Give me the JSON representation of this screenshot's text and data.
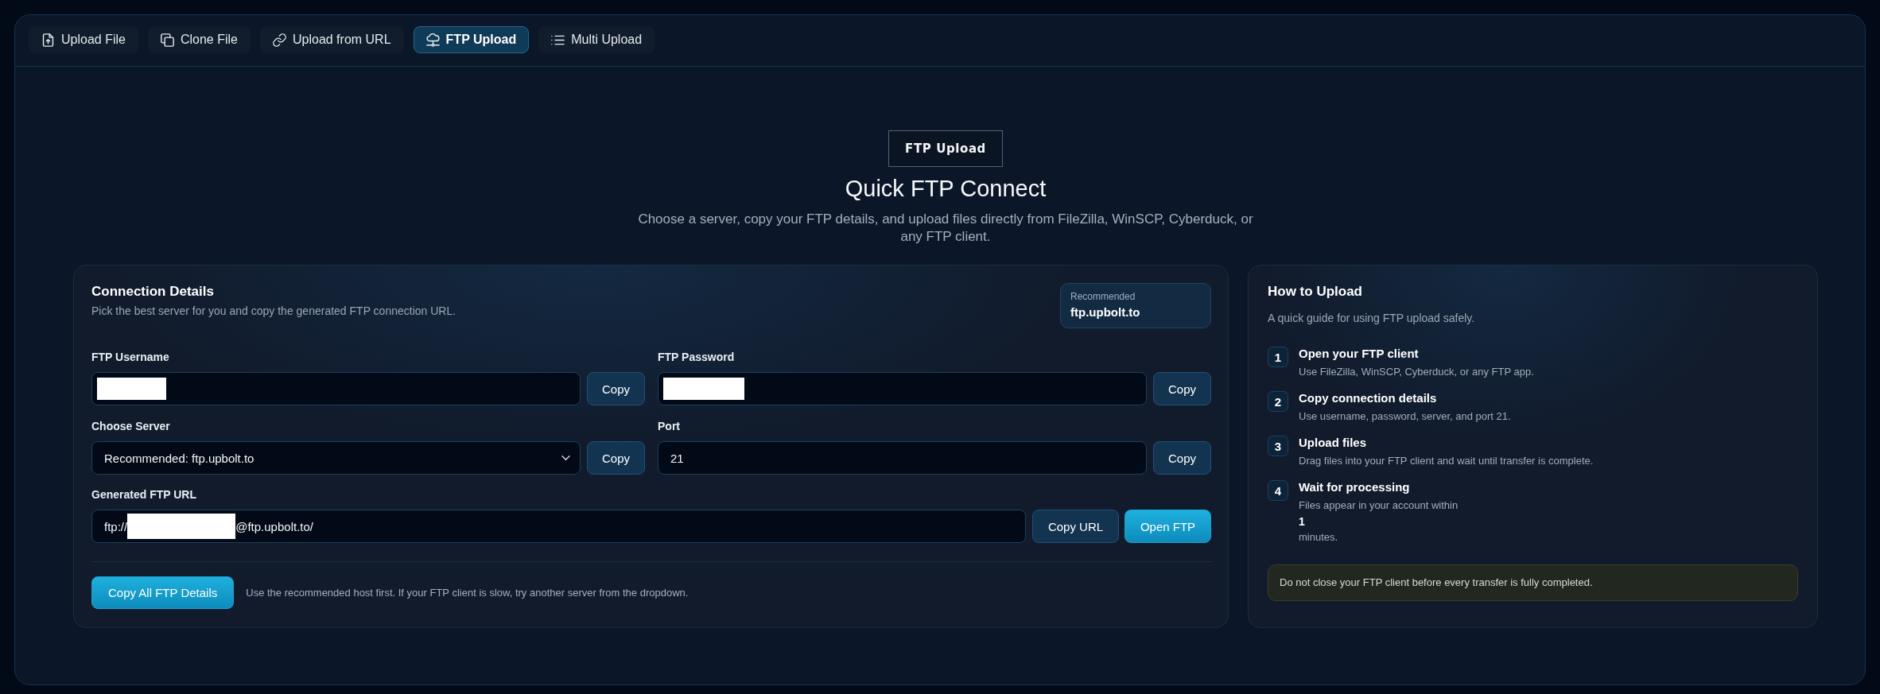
{
  "tabs": [
    {
      "label": "Upload File",
      "selected": false
    },
    {
      "label": "Clone File",
      "selected": false
    },
    {
      "label": "Upload from URL",
      "selected": false
    },
    {
      "label": "FTP Upload",
      "selected": true
    },
    {
      "label": "Multi Upload",
      "selected": false
    }
  ],
  "hero": {
    "badge": "FTP Upload",
    "title": "Quick FTP Connect",
    "subtitle": "Choose a server, copy your FTP details, and upload files directly from FileZilla, WinSCP, Cyberduck, or any FTP client."
  },
  "connection": {
    "title": "Connection Details",
    "subtitle": "Pick the best server for you and copy the generated FTP connection URL.",
    "recommended": {
      "label": "Recommended",
      "host": "ftp.upbolt.to"
    },
    "fields": [
      {
        "label": "FTP Username",
        "kind": "input",
        "redacted": true,
        "button": "Copy"
      },
      {
        "label": "FTP Password",
        "kind": "input",
        "redacted": true,
        "button": "Copy"
      },
      {
        "label": "Choose Server",
        "kind": "select",
        "redacted": false,
        "value": "Recommended: ftp.upbolt.to",
        "button": "Copy"
      },
      {
        "label": "Port",
        "kind": "input",
        "redacted": false,
        "value": "21",
        "button": "Copy"
      }
    ],
    "url": {
      "label": "Generated FTP URL",
      "prefix": "ftp://",
      "redacted": true,
      "suffix": "@ftp.upbolt.to/",
      "buttons": [
        {
          "label": "Copy URL",
          "kind": "secondary"
        },
        {
          "label": "Open FTP",
          "kind": "primary"
        }
      ]
    },
    "footer": {
      "button": "Copy All FTP Details",
      "note": "Use the recommended host first. If your FTP client is slow, try another server from the dropdown."
    }
  },
  "guide": {
    "title": "How to Upload",
    "subtitle": "A quick guide for using FTP upload safely.",
    "steps": [
      {
        "number": "1",
        "title": "Open your FTP client",
        "lines": [
          {
            "text": "Use FileZilla, WinSCP, Cyberduck, or any FTP app.",
            "strong": false
          }
        ]
      },
      {
        "number": "2",
        "title": "Copy connection details",
        "lines": [
          {
            "text": "Use username, password, server, and port 21.",
            "strong": false
          }
        ]
      },
      {
        "number": "3",
        "title": "Upload files",
        "lines": [
          {
            "text": "Drag files into your FTP client and wait until transfer is complete.",
            "strong": false
          }
        ]
      },
      {
        "number": "4",
        "title": "Wait for processing",
        "lines": [
          {
            "text": "Files appear in your account within",
            "strong": false
          },
          {
            "text": "1",
            "strong": true
          },
          {
            "text": "minutes.",
            "strong": false
          }
        ]
      }
    ],
    "warning": "Do not close your FTP client before every transfer is fully completed."
  }
}
